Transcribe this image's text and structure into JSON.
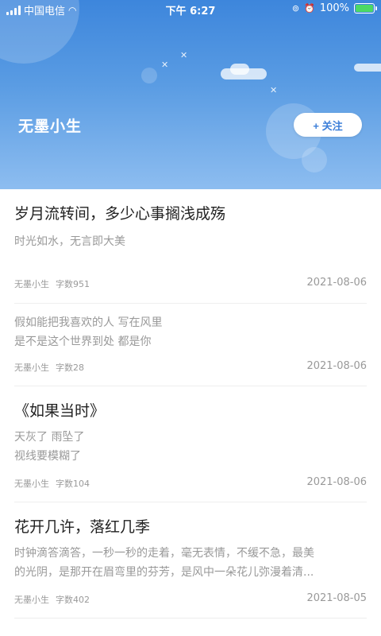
{
  "status_bar": {
    "carrier": "中国电信",
    "time": "下午 6:27",
    "battery": "100%",
    "battery_level": 1.0
  },
  "profile": {
    "name": "无墨小生",
    "follow_label": "+ 关注"
  },
  "posts": [
    {
      "title": "岁月流转间，多少心事搁浅成殇",
      "excerpt": "时光如水，无言即大美",
      "author": "无墨小生",
      "word_count": "字数951",
      "date": "2021-08-06"
    },
    {
      "title": "",
      "excerpt": "假如能把我喜欢的人 写在风里\n是不是这个世界到处 都是你",
      "author": "无墨小生",
      "word_count": "字数28",
      "date": "2021-08-06"
    },
    {
      "title": "《如果当时》",
      "excerpt": "天灰了 雨坠了\n视线要模糊了",
      "author": "无墨小生",
      "word_count": "字数104",
      "date": "2021-08-06"
    },
    {
      "title": "花开几许，落红几季",
      "excerpt": "时钟滴答滴答，一秒一秒的走着，毫无表情，不缓不急，最美\n的光阴，是那开在眉弯里的芬芳，是风中一朵花儿弥漫着清...",
      "author": "无墨小生",
      "word_count": "字数402",
      "date": "2021-08-05"
    }
  ]
}
